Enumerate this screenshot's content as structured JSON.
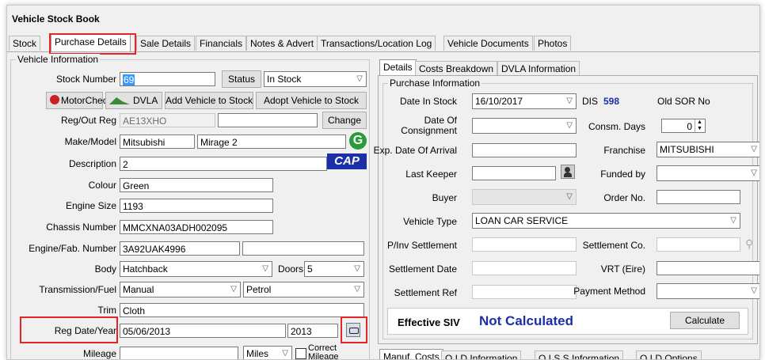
{
  "window": {
    "title": "Vehicle Stock Book"
  },
  "tabs": [
    "Stock",
    "Purchase Details",
    "Sale Details",
    "Financials",
    "Notes & Advert",
    "Transactions/Location Log",
    "Vehicle Documents",
    "Photos"
  ],
  "vehicle_info": {
    "group_label": "Vehicle Information",
    "stock_number_label": "Stock Number",
    "stock_number": "69",
    "status_button": "Status",
    "status_value": "In Stock",
    "motorcheck": "MotorCheck",
    "dvla": "DVLA",
    "add_vehicle": "Add Vehicle to Stock",
    "adopt_vehicle": "Adopt Vehicle to Stock",
    "reg_label": "Reg/Out Reg",
    "reg": "AE13XHO",
    "change_button": "Change",
    "make_label": "Make/Model",
    "make": "Mitsubishi",
    "model": "Mirage 2",
    "g_logo": "G",
    "desc_label": "Description",
    "description": "2",
    "cap_logo": "CAP",
    "colour_label": "Colour",
    "colour": "Green",
    "engine_size_label": "Engine Size",
    "engine_size": "1193",
    "chassis_label": "Chassis Number",
    "chassis": "MMCXNA03ADH002095",
    "engine_fab_label": "Engine/Fab. Number",
    "engine_fab": "3A92UAK4996",
    "body_label": "Body",
    "body": "Hatchback",
    "doors_label": "Doors",
    "doors": "5",
    "trans_label": "Transmission/Fuel",
    "transmission": "Manual",
    "fuel": "Petrol",
    "trim_label": "Trim",
    "trim": "Cloth",
    "regdate_label": "Reg Date/Year",
    "reg_date": "05/06/2013",
    "reg_year": "2013",
    "mileage_label": "Mileage",
    "mileage_unit": "Miles",
    "correct_mileage": "Correct Mileage"
  },
  "right_tabs": [
    "Details",
    "Costs Breakdown",
    "DVLA Information"
  ],
  "purchase_info": {
    "group_label": "Purchase Information",
    "date_in_stock_label": "Date In Stock",
    "date_in_stock": "16/10/2017",
    "dis_label": "DIS",
    "dis_value": "598",
    "old_sor_label": "Old SOR No",
    "date_consign_label_1": "Date Of",
    "date_consign_label_2": "Consignment",
    "consm_days_label": "Consm. Days",
    "consm_days": "0",
    "exp_date_label": "Exp. Date Of Arrival",
    "franchise_label": "Franchise",
    "franchise": "MITSUBISHI",
    "last_keeper_label": "Last Keeper",
    "funded_by_label": "Funded by",
    "buyer_label": "Buyer",
    "order_no_label": "Order No.",
    "vehicle_type_label": "Vehicle Type",
    "vehicle_type": "LOAN CAR SERVICE",
    "pinv_label": "P/Inv Settlement",
    "settlement_co_label": "Settlement Co.",
    "settlement_date_label": "Settlement Date",
    "vrt_label": "VRT (Eire)",
    "settlement_ref_label": "Settlement Ref",
    "payment_method_label": "Payment Method",
    "effective_siv_label": "Effective SIV",
    "effective_siv_value": "Not Calculated",
    "calculate_button": "Calculate"
  },
  "bottom_tabs": [
    "Manuf. Costs",
    "O.I.D Information",
    "O.I.S.S Information",
    "O.I.D Options"
  ],
  "colors": {
    "highlight": "#e5252b",
    "accent_blue": "#1b2fa8",
    "selection": "#3399ff"
  }
}
